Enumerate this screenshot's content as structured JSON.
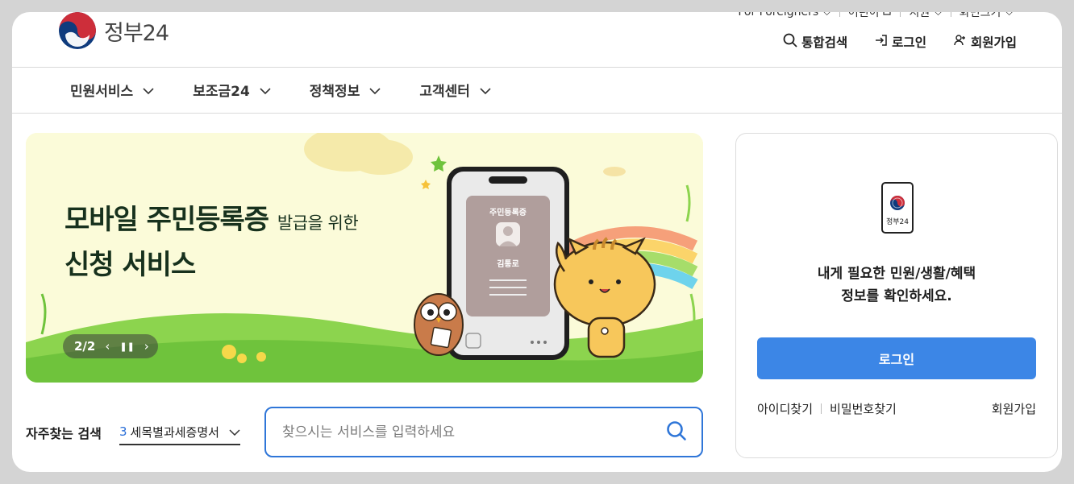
{
  "header": {
    "logo_text": "정부24",
    "util": {
      "foreigners": "For Foreigners",
      "kids": "어린이",
      "support": "지원",
      "screen_size": "화면크기"
    },
    "top_nav": {
      "search": "통합검색",
      "login": "로그인",
      "signup": "회원가입"
    }
  },
  "main_nav": [
    {
      "label": "민원서비스"
    },
    {
      "label": "보조금24"
    },
    {
      "label": "정책정보"
    },
    {
      "label": "고객센터"
    }
  ],
  "banner": {
    "title_line1": "모바일 주민등록증",
    "title_suffix": "발급을 위한",
    "title_line2": "신청 서비스",
    "card_title": "주민등록증",
    "card_name": "김통로",
    "pager": "2/2"
  },
  "search": {
    "fav_label": "자주찾는 검색",
    "fav_num": "3",
    "fav_value": "세목별과세증명서",
    "placeholder": "찾으시는 서비스를 입력하세요"
  },
  "login_panel": {
    "icon_text": "정부24",
    "message_line1": "내게 필요한 민원/생활/혜택",
    "message_line2": "정보를 확인하세요.",
    "login_button": "로그인",
    "find_id": "아이디찾기",
    "find_pw": "비밀번호찾기",
    "signup": "회원가입"
  },
  "colors": {
    "accent": "#3c86e6",
    "brand_red": "#cd2e3a",
    "brand_blue": "#0f3b7d"
  }
}
